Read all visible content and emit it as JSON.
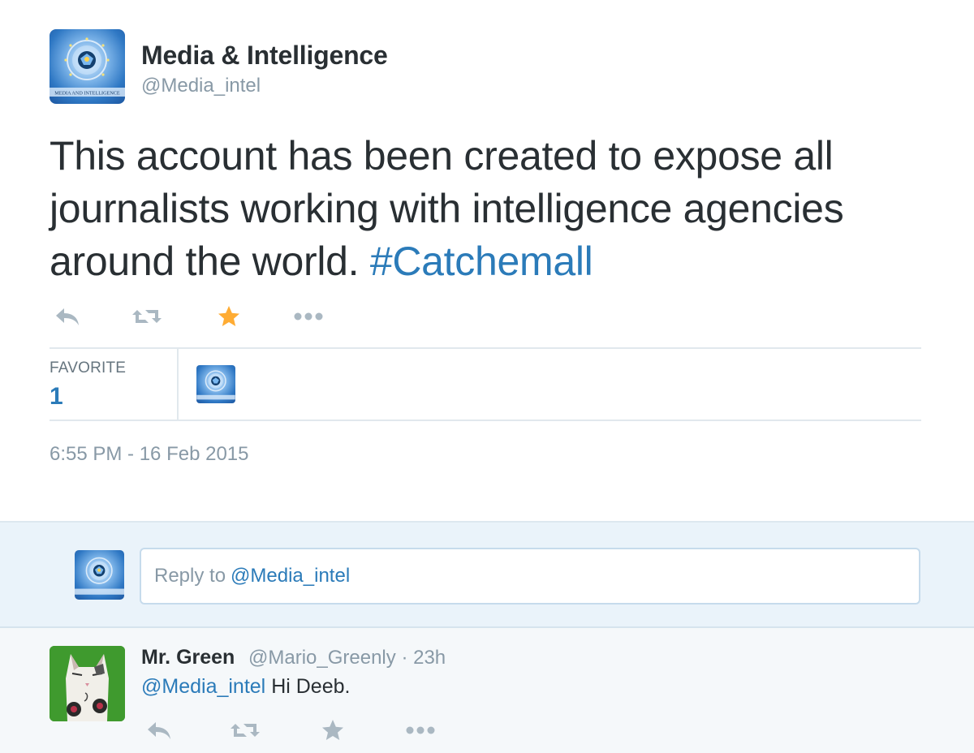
{
  "tweet": {
    "author_name": "Media & Intelligence",
    "author_handle": "@Media_intel",
    "avatar_caption": "MEDIA AND INTELLIGENCE",
    "text_before_hashtag": "This account has been created to expose all journalists working with intelligence agencies around the world. ",
    "hashtag": "#Catchemall",
    "actions": [
      {
        "name": "reply",
        "icon": "reply-icon",
        "color": "#aab8c2"
      },
      {
        "name": "retweet",
        "icon": "retweet-icon",
        "color": "#aab8c2"
      },
      {
        "name": "favorite",
        "icon": "star-icon",
        "color": "#ffac33",
        "active": true
      },
      {
        "name": "more",
        "icon": "more-icon",
        "color": "#aab8c2"
      }
    ],
    "stats": {
      "favorite_label": "FAVORITE",
      "favorite_count": "1"
    },
    "timestamp": "6:55 PM - 16 Feb 2015"
  },
  "reply_box": {
    "placeholder_prefix": "Reply to",
    "placeholder_mention": "@Media_intel"
  },
  "replies": [
    {
      "author_name": "Mr. Green",
      "author_handle": "@Mario_Greenly",
      "separator": "·",
      "time": "23h",
      "mention": "@Media_intel",
      "text": "Hi Deeb.",
      "actions": [
        {
          "name": "reply",
          "icon": "reply-icon",
          "color": "#aab8c2"
        },
        {
          "name": "retweet",
          "icon": "retweet-icon",
          "color": "#aab8c2"
        },
        {
          "name": "favorite",
          "icon": "star-icon",
          "color": "#aab8c2"
        },
        {
          "name": "more",
          "icon": "more-icon",
          "color": "#aab8c2"
        }
      ]
    }
  ],
  "colors": {
    "link": "#2b7bb9",
    "muted": "#8899a6",
    "text": "#292f33",
    "favorite_active": "#ffac33",
    "reply_bar_bg": "#eaf3fa"
  }
}
